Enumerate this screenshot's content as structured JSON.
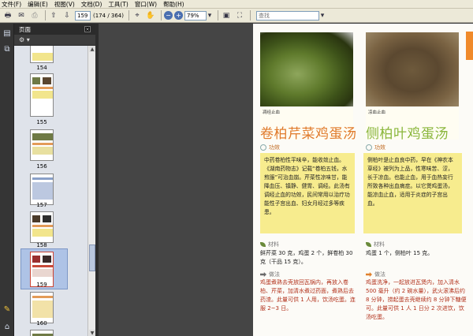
{
  "menu": [
    "文件(F)",
    "编辑(E)",
    "视图(V)",
    "文档(D)",
    "工具(T)",
    "窗口(W)",
    "帮助(H)"
  ],
  "toolbar": {
    "page_current": "159",
    "page_total_text": "(174 / 364)",
    "zoom": "79%",
    "search_placeholder": "查找"
  },
  "panel": {
    "title": "页面",
    "close": "×",
    "options_icon_text": "⚙ ▾"
  },
  "thumbnails": [
    {
      "label": "154"
    },
    {
      "label": "155"
    },
    {
      "label": "156"
    },
    {
      "label": "157"
    },
    {
      "label": "158"
    },
    {
      "label": "159",
      "selected": true
    },
    {
      "label": "160"
    }
  ],
  "page": {
    "left": {
      "caption": "凋经止血",
      "title": "卷柏芹菜鸡蛋汤",
      "effect_label": "功效",
      "effect_text": "中药卷柏性平味辛，能收敛止血。《湖南药物志》记载“卷柏五钱，水煎服”可治血崩。芹菜性凉味甘，能降血压、镇静、健胃、调经。此汤有调经止血的功效，民间常用以治疗功能性子宫出血、妇女月经过多等疾患。",
      "material_label": "材料",
      "material_text": "鲜芹菜 30 克，鸡蛋 2 个，鲜卷柏 30 克（干品 15 克）。",
      "method_label": "做法",
      "method_text": "鸡蛋煮熟去壳放回瓦锅内，再放入卷柏、芹菜，加清水煮过药面，煮熟后去药渣。此量可供 1 人用，饮汤吃蛋。连服 2~3 日。"
    },
    "right": {
      "caption": "凉血止血",
      "title": "侧柏叶鸡蛋汤",
      "effect_label": "功效",
      "effect_text": "侧柏叶是止血良中药，早在《神农本草经》被列为上品，性寒味苦、涩，长于凉血。也能止血，用于血热妄行所致各种出血病症。以它煲鸡蛋汤，能凉血止血，适用于炎症的子宫出血。",
      "material_label": "材料",
      "material_text": "鸡蛋 1 个，侧柏叶 15 克。",
      "method_label": "做法",
      "method_text": "鸡蛋洗净，一起放进瓦煲内，加入清水 500 毫升（约 2 碗水量），武火滚沸后约 8 分钟，捞起蛋去壳继续约 8 分钟下糖便可。此量可供 1 人 1 日分 2 次进饮，饮汤吃蛋。"
    }
  },
  "colors": {
    "title_left": "#e07b2c",
    "title_right": "#8ab63b",
    "highlight_box": "#f7ec8e",
    "method_text": "#b2311b"
  }
}
